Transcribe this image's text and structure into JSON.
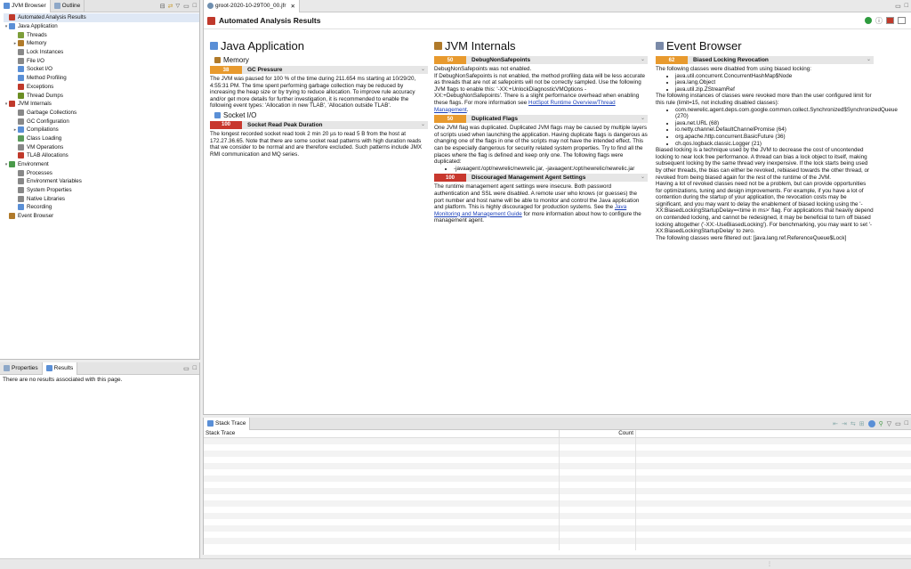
{
  "left_tabs": [
    "JVM Browser",
    "Outline"
  ],
  "tree": [
    {
      "label": "Automated Analysis Results",
      "level": 0,
      "twisty": "",
      "icon": "#c0392b",
      "selected": true
    },
    {
      "label": "Java Application",
      "level": 0,
      "twisty": "▾",
      "icon": "#5a8fd6"
    },
    {
      "label": "Threads",
      "level": 1,
      "twisty": "",
      "icon": "#7d9e3a"
    },
    {
      "label": "Memory",
      "level": 1,
      "twisty": "▸",
      "icon": "#b07a2a"
    },
    {
      "label": "Lock Instances",
      "level": 1,
      "twisty": "",
      "icon": "#888"
    },
    {
      "label": "File I/O",
      "level": 1,
      "twisty": "",
      "icon": "#888"
    },
    {
      "label": "Socket I/O",
      "level": 1,
      "twisty": "",
      "icon": "#5a8fd6"
    },
    {
      "label": "Method Profiling",
      "level": 1,
      "twisty": "",
      "icon": "#5a8fd6"
    },
    {
      "label": "Exceptions",
      "level": 1,
      "twisty": "",
      "icon": "#c0392b"
    },
    {
      "label": "Thread Dumps",
      "level": 1,
      "twisty": "",
      "icon": "#6b8e23"
    },
    {
      "label": "JVM Internals",
      "level": 0,
      "twisty": "▾",
      "icon": "#c0392b"
    },
    {
      "label": "Garbage Collections",
      "level": 1,
      "twisty": "",
      "icon": "#888"
    },
    {
      "label": "GC Configuration",
      "level": 1,
      "twisty": "",
      "icon": "#888"
    },
    {
      "label": "Compilations",
      "level": 1,
      "twisty": "▸",
      "icon": "#5a8fd6"
    },
    {
      "label": "Class Loading",
      "level": 1,
      "twisty": "",
      "icon": "#5b9b5b"
    },
    {
      "label": "VM Operations",
      "level": 1,
      "twisty": "",
      "icon": "#888"
    },
    {
      "label": "TLAB Allocations",
      "level": 1,
      "twisty": "",
      "icon": "#c0392b"
    },
    {
      "label": "Environment",
      "level": 0,
      "twisty": "▾",
      "icon": "#4a9a4a"
    },
    {
      "label": "Processes",
      "level": 1,
      "twisty": "",
      "icon": "#888"
    },
    {
      "label": "Environment Variables",
      "level": 1,
      "twisty": "",
      "icon": "#888"
    },
    {
      "label": "System Properties",
      "level": 1,
      "twisty": "",
      "icon": "#888"
    },
    {
      "label": "Native Libraries",
      "level": 1,
      "twisty": "",
      "icon": "#888"
    },
    {
      "label": "Recording",
      "level": 1,
      "twisty": "",
      "icon": "#5a8fd6"
    },
    {
      "label": "Event Browser",
      "level": 0,
      "twisty": "",
      "icon": "#b07a2a"
    }
  ],
  "bottom_tabs": [
    "Properties",
    "Results"
  ],
  "results_empty": "There are no results associated with this page.",
  "editor_tab": "groot-2020-10-29T00_00.jfr",
  "page_title": "Automated Analysis Results",
  "col1": {
    "title": "Java Application",
    "sections": [
      {
        "heading": "Memory",
        "rules": [
          {
            "score": "38",
            "color": "#e89a2e",
            "title": "GC Pressure",
            "text": "The JVM was paused for 100 % of the time during 211.654 ms starting at 10/29/20, 4:55:31 PM. The time spent performing garbage collection may be reduced by increasing the heap size or by trying to reduce allocation. To improve rule accuracy and/or get more details for further investigation, it is recommended to enable the following event types: 'Allocation in new TLAB', 'Allocation outside TLAB'."
          }
        ]
      },
      {
        "heading": "Socket I/O",
        "rules": [
          {
            "score": "100",
            "color": "#c8382e",
            "title": "Socket Read Peak Duration",
            "text": "The longest recorded socket read took 2 min 20 µs to read 5 B from the host at 172.27.36.65. Note that there are some socket read patterns with high duration reads that we consider to be normal and are therefore excluded. Such patterns include JMX RMI communication and MQ series."
          }
        ]
      }
    ]
  },
  "col2": {
    "title": "JVM Internals",
    "rule1": {
      "score": "50",
      "color": "#e89a2e",
      "title": "DebugNonSafepoints",
      "text_a": "DebugNonSafepoints was not enabled.",
      "text_b": "If DebugNonSafepoints is not enabled, the method profiling data will be less accurate as threads that are not at safepoints will not be correctly sampled. Use the following JVM flags to enable this: '-XX:+UnlockDiagnosticVMOptions -XX:+DebugNonSafepoints'. There is a slight performance overhead when enabling these flags. For more information see",
      "link": "HotSpot Runtime Overview/Thread Management",
      "text_c": "."
    },
    "rule2": {
      "score": "50",
      "color": "#e89a2e",
      "title": "Duplicated Flags",
      "text": "One JVM flag was duplicated. Duplicated JVM flags may be caused by multiple layers of scripts used when launching the application. Having duplicate flags is dangerous as changing one of the flags in one of the scripts may not have the intended effect. This can be especially dangerous for security related system properties. Try to find all the places where the flag is defined and keep only one. The following flags were duplicated:",
      "items": [
        "-javaagent:/opt/newrelic/newrelic.jar, -javaagent:/opt/newrelic/newrelic.jar"
      ]
    },
    "rule3": {
      "score": "100",
      "color": "#c8382e",
      "title": "Discouraged Management Agent Settings",
      "text_a": "The runtime management agent settings were insecure. Both password authentication and SSL were disabled. A remote user who knows (or guesses) the port number and host name will be able to monitor and control the Java application and platform. This is highly discouraged for production systems. See the",
      "link": "Java Monitoring and Management Guide",
      "text_b": "for more information about how to configure the management agent."
    }
  },
  "col3": {
    "title": "Event Browser",
    "rule": {
      "score": "62",
      "color": "#e89a2e",
      "title": "Biased Locking Revocation",
      "text_a": "The following classes were disabled from using biased locking:",
      "list_a": [
        "java.util.concurrent.ConcurrentHashMap$Node",
        "java.lang.Object",
        "java.util.zip.ZStreamRef"
      ],
      "text_b": "The following instances of classes were revoked more than the user configured limit for this rule (limit=15, not including disabled classes):",
      "list_b": [
        "com.newrelic.agent.deps.com.google.common.collect.Synchronized$SynchronizedQueue (270)",
        "java.net.URL (68)",
        "io.netty.channel.DefaultChannelPromise (64)",
        "org.apache.http.concurrent.BasicFuture (36)",
        "ch.qos.logback.classic.Logger (21)"
      ],
      "text_c": "Biased locking is a technique used by the JVM to decrease the cost of uncontended locking to near lock free performance. A thread can bias a lock object to itself, making subsequent locking by the same thread very inexpensive. If the lock starts being used by other threads, the bias can either be revoked, rebiased towards the other thread, or revoked from being biased again for the rest of the runtime of the JVM.",
      "text_d": "Having a lot of revoked classes need not be a problem, but can provide opportunities for optimizations, tuning and design improvements. For example, if you have a lot of contention during the startup of your application, the revocation costs may be significant, and you may want to delay the enablement of biased locking using the '-XX:BiasedLockingStartupDelay=<time in ms>' flag. For applications that heavily depend on contended locking, and cannot be redesigned, it may be beneficial to turn off biased locking altogether ('-XX:-UseBiasedLocking'). For benchmarking, you may want to set '-XX:BiasedLockingStartupDelay' to zero.",
      "text_e": "The following classes were filtered out: [java.lang.ref.ReferenceQueue$Lock]"
    }
  },
  "stack": {
    "tab": "Stack Trace",
    "col_trace": "Stack Trace",
    "col_count": "Count"
  }
}
